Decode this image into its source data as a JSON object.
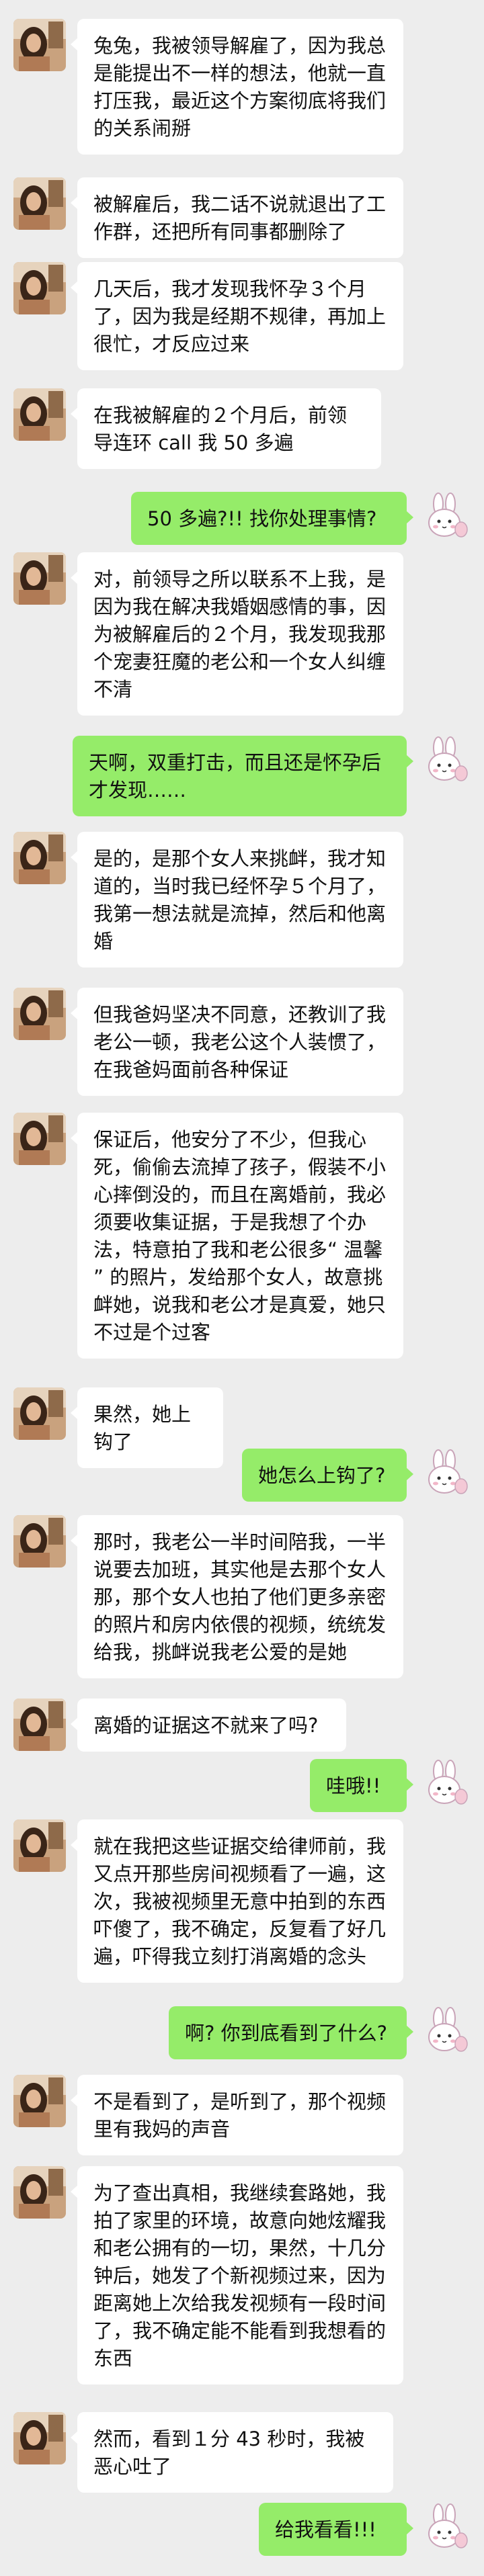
{
  "colors": {
    "background": "#ededed",
    "incoming_bubble": "#ffffff",
    "outgoing_bubble": "#95ec69"
  },
  "avatars": {
    "left": "woman-photo-avatar",
    "right": "cartoon-rabbit-avatar"
  },
  "messages": [
    {
      "side": "left",
      "text": "兔兔，我被领导解雇了，因为我总是能提出不一样的想法，他就一直打压我，最近这个方案彻底将我们的关系闹掰"
    },
    {
      "side": "left",
      "text": "被解雇后，我二话不说就退出了工作群，还把所有同事都删除了"
    },
    {
      "side": "left",
      "text": "几天后，我才发现我怀孕３个月了，因为我是经期不规律，再加上很忙，才反应过来"
    },
    {
      "side": "left",
      "text": "在我被解雇的２个月后，前领导连环 call 我 50 多遍"
    },
    {
      "side": "right",
      "text": "50 多遍?!! 找你处理事情?"
    },
    {
      "side": "left",
      "text": "对，前领导之所以联系不上我，是因为我在解决我婚姻感情的事，因为被解雇后的２个月，我发现我那个宠妻狂魔的老公和一个女人纠缠不清"
    },
    {
      "side": "right",
      "text": "天啊，双重打击，而且还是怀孕后才发现……"
    },
    {
      "side": "left",
      "text": "是的，是那个女人来挑衅，我才知道的，当时我已经怀孕５个月了，我第一想法就是流掉，然后和他离婚"
    },
    {
      "side": "left",
      "text": "但我爸妈坚决不同意，还教训了我老公一顿，我老公这个人装惯了，在我爸妈面前各种保证"
    },
    {
      "side": "left",
      "text": "保证后，他安分了不少，但我心死，偷偷去流掉了孩子，假装不小心摔倒没的，而且在离婚前，我必须要收集证据，于是我想了个办法，特意拍了我和老公很多“ 温馨 ” 的照片，发给那个女人，故意挑衅她，说我和老公才是真爱，她只不过是个过客"
    },
    {
      "side": "left",
      "text": "果然，她上钩了"
    },
    {
      "side": "right",
      "text": "她怎么上钩了?"
    },
    {
      "side": "left",
      "text": "那时，我老公一半时间陪我，一半说要去加班，其实他是去那个女人那，那个女人也拍了他们更多亲密的照片和房内依偎的视频，统统发给我，挑衅说我老公爱的是她"
    },
    {
      "side": "left",
      "text": "离婚的证据这不就来了吗?"
    },
    {
      "side": "right",
      "text": "哇哦!!"
    },
    {
      "side": "left",
      "text": "就在我把这些证据交给律师前，我又点开那些房间视频看了一遍，这次，我被视频里无意中拍到的东西吓傻了，我不确定，反复看了好几遍，吓得我立刻打消离婚的念头"
    },
    {
      "side": "right",
      "text": "啊? 你到底看到了什么?"
    },
    {
      "side": "left",
      "text": "不是看到了，是听到了，那个视频里有我妈的声音"
    },
    {
      "side": "left",
      "text": "为了查出真相，我继续套路她，我拍了家里的环境，故意向她炫耀我和老公拥有的一切，果然，十几分钟后，她发了个新视频过来，因为距离她上次给我发视频有一段时间了，我不确定能不能看到我想看的东西"
    },
    {
      "side": "left",
      "text": "然而，看到１分 43 秒时，我被恶心吐了"
    },
    {
      "side": "right",
      "text": "给我看看!!!"
    }
  ]
}
